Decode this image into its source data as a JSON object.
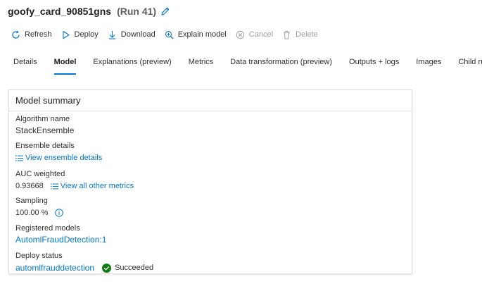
{
  "header": {
    "run_name": "goofy_card_90851gns",
    "run_number": "(Run 41)"
  },
  "toolbar": {
    "refresh": "Refresh",
    "deploy": "Deploy",
    "download": "Download",
    "explain_model": "Explain model",
    "cancel": "Cancel",
    "delete": "Delete"
  },
  "tabs": {
    "details": "Details",
    "model": "Model",
    "explanations": "Explanations (preview)",
    "metrics": "Metrics",
    "data_transformation": "Data transformation (preview)",
    "outputs_logs": "Outputs + logs",
    "images": "Images",
    "child_runs": "Child runs"
  },
  "summary": {
    "title": "Model summary",
    "algorithm_label": "Algorithm name",
    "algorithm_value": "StackEnsemble",
    "ensemble_label": "Ensemble details",
    "ensemble_link": "View ensemble details",
    "auc_label": "AUC weighted",
    "auc_value": "0.93668",
    "metrics_link": "View all other metrics",
    "sampling_label": "Sampling",
    "sampling_value": "100.00 %",
    "registered_label": "Registered models",
    "registered_value": "AutomlFraudDetection:1",
    "deploy_label": "Deploy status",
    "deploy_link": "automlfrauddetection",
    "deploy_status": "Succeeded"
  },
  "colors": {
    "accent": "#0078d4",
    "success": "#107c10",
    "disabled": "#a19f9d"
  },
  "icons": [
    "edit-icon",
    "refresh-icon",
    "deploy-icon",
    "download-icon",
    "explain-icon",
    "cancel-icon",
    "delete-icon",
    "list-icon",
    "info-icon",
    "success-icon"
  ]
}
